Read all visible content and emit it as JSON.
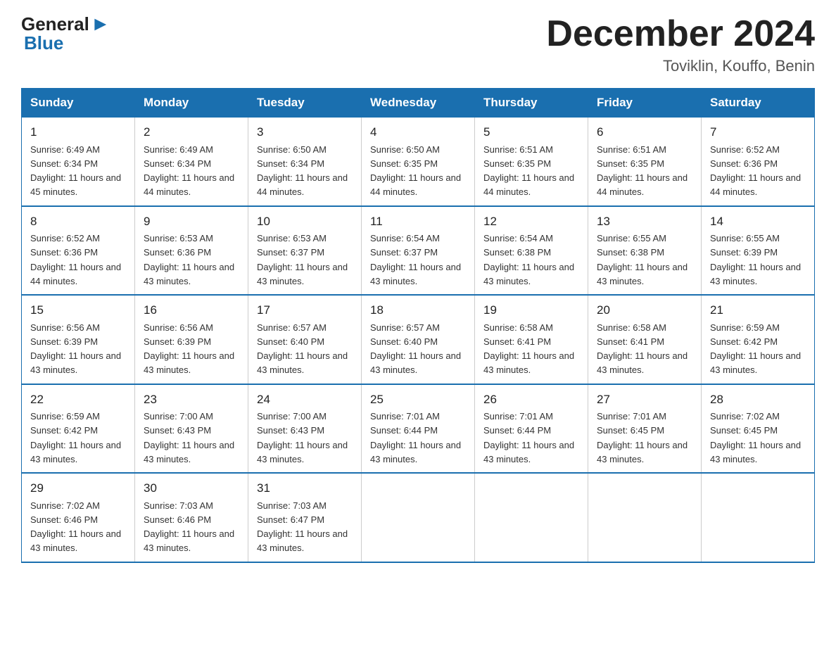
{
  "header": {
    "logo_general": "General",
    "logo_blue": "Blue",
    "month_title": "December 2024",
    "location": "Toviklin, Kouffo, Benin"
  },
  "weekdays": [
    "Sunday",
    "Monday",
    "Tuesday",
    "Wednesday",
    "Thursday",
    "Friday",
    "Saturday"
  ],
  "weeks": [
    [
      {
        "day": "1",
        "sunrise": "6:49 AM",
        "sunset": "6:34 PM",
        "daylight": "11 hours and 45 minutes."
      },
      {
        "day": "2",
        "sunrise": "6:49 AM",
        "sunset": "6:34 PM",
        "daylight": "11 hours and 44 minutes."
      },
      {
        "day": "3",
        "sunrise": "6:50 AM",
        "sunset": "6:34 PM",
        "daylight": "11 hours and 44 minutes."
      },
      {
        "day": "4",
        "sunrise": "6:50 AM",
        "sunset": "6:35 PM",
        "daylight": "11 hours and 44 minutes."
      },
      {
        "day": "5",
        "sunrise": "6:51 AM",
        "sunset": "6:35 PM",
        "daylight": "11 hours and 44 minutes."
      },
      {
        "day": "6",
        "sunrise": "6:51 AM",
        "sunset": "6:35 PM",
        "daylight": "11 hours and 44 minutes."
      },
      {
        "day": "7",
        "sunrise": "6:52 AM",
        "sunset": "6:36 PM",
        "daylight": "11 hours and 44 minutes."
      }
    ],
    [
      {
        "day": "8",
        "sunrise": "6:52 AM",
        "sunset": "6:36 PM",
        "daylight": "11 hours and 44 minutes."
      },
      {
        "day": "9",
        "sunrise": "6:53 AM",
        "sunset": "6:36 PM",
        "daylight": "11 hours and 43 minutes."
      },
      {
        "day": "10",
        "sunrise": "6:53 AM",
        "sunset": "6:37 PM",
        "daylight": "11 hours and 43 minutes."
      },
      {
        "day": "11",
        "sunrise": "6:54 AM",
        "sunset": "6:37 PM",
        "daylight": "11 hours and 43 minutes."
      },
      {
        "day": "12",
        "sunrise": "6:54 AM",
        "sunset": "6:38 PM",
        "daylight": "11 hours and 43 minutes."
      },
      {
        "day": "13",
        "sunrise": "6:55 AM",
        "sunset": "6:38 PM",
        "daylight": "11 hours and 43 minutes."
      },
      {
        "day": "14",
        "sunrise": "6:55 AM",
        "sunset": "6:39 PM",
        "daylight": "11 hours and 43 minutes."
      }
    ],
    [
      {
        "day": "15",
        "sunrise": "6:56 AM",
        "sunset": "6:39 PM",
        "daylight": "11 hours and 43 minutes."
      },
      {
        "day": "16",
        "sunrise": "6:56 AM",
        "sunset": "6:39 PM",
        "daylight": "11 hours and 43 minutes."
      },
      {
        "day": "17",
        "sunrise": "6:57 AM",
        "sunset": "6:40 PM",
        "daylight": "11 hours and 43 minutes."
      },
      {
        "day": "18",
        "sunrise": "6:57 AM",
        "sunset": "6:40 PM",
        "daylight": "11 hours and 43 minutes."
      },
      {
        "day": "19",
        "sunrise": "6:58 AM",
        "sunset": "6:41 PM",
        "daylight": "11 hours and 43 minutes."
      },
      {
        "day": "20",
        "sunrise": "6:58 AM",
        "sunset": "6:41 PM",
        "daylight": "11 hours and 43 minutes."
      },
      {
        "day": "21",
        "sunrise": "6:59 AM",
        "sunset": "6:42 PM",
        "daylight": "11 hours and 43 minutes."
      }
    ],
    [
      {
        "day": "22",
        "sunrise": "6:59 AM",
        "sunset": "6:42 PM",
        "daylight": "11 hours and 43 minutes."
      },
      {
        "day": "23",
        "sunrise": "7:00 AM",
        "sunset": "6:43 PM",
        "daylight": "11 hours and 43 minutes."
      },
      {
        "day": "24",
        "sunrise": "7:00 AM",
        "sunset": "6:43 PM",
        "daylight": "11 hours and 43 minutes."
      },
      {
        "day": "25",
        "sunrise": "7:01 AM",
        "sunset": "6:44 PM",
        "daylight": "11 hours and 43 minutes."
      },
      {
        "day": "26",
        "sunrise": "7:01 AM",
        "sunset": "6:44 PM",
        "daylight": "11 hours and 43 minutes."
      },
      {
        "day": "27",
        "sunrise": "7:01 AM",
        "sunset": "6:45 PM",
        "daylight": "11 hours and 43 minutes."
      },
      {
        "day": "28",
        "sunrise": "7:02 AM",
        "sunset": "6:45 PM",
        "daylight": "11 hours and 43 minutes."
      }
    ],
    [
      {
        "day": "29",
        "sunrise": "7:02 AM",
        "sunset": "6:46 PM",
        "daylight": "11 hours and 43 minutes."
      },
      {
        "day": "30",
        "sunrise": "7:03 AM",
        "sunset": "6:46 PM",
        "daylight": "11 hours and 43 minutes."
      },
      {
        "day": "31",
        "sunrise": "7:03 AM",
        "sunset": "6:47 PM",
        "daylight": "11 hours and 43 minutes."
      },
      null,
      null,
      null,
      null
    ]
  ]
}
